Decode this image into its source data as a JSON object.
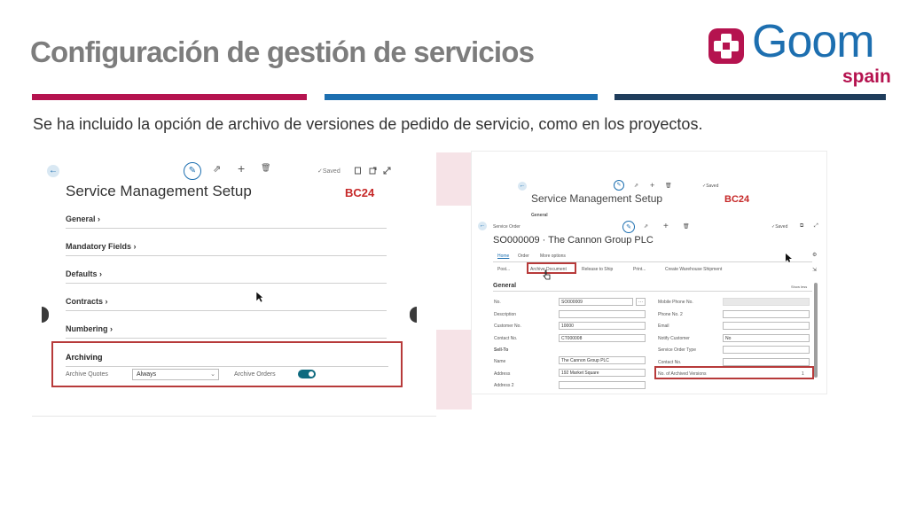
{
  "slide": {
    "title": "Configuración de gestión de servicios",
    "subtitle": "Se ha incluido la opción de archivo de versiones de pedido de servicio, como en los proyectos.",
    "logo": {
      "name": "Goom",
      "region": "spain"
    }
  },
  "left_panel": {
    "toolbar": {
      "edit_icon": "✎",
      "share_icon": "⇗",
      "add_icon": "+",
      "delete_icon": "🗑",
      "saved": "✓Saved"
    },
    "page_title": "Service Management Setup",
    "badge": "BC24",
    "sections": [
      "General ›",
      "Mandatory Fields ›",
      "Defaults ›",
      "Contracts ›",
      "Numbering ›"
    ],
    "archiving": {
      "heading": "Archiving",
      "archive_quotes_label": "Archive Quotes",
      "archive_quotes_value": "Always",
      "archive_orders_label": "Archive Orders"
    }
  },
  "right_panel": {
    "setup_title": "Service Management Setup",
    "setup_badge": "BC24",
    "setup_general": "General",
    "saved": "✓Saved",
    "breadcrumb": "Service Order",
    "record_title": "SO000009 · The Cannon Group PLC",
    "tabs": [
      "Home",
      "Order",
      "More options"
    ],
    "actions": {
      "post": "Post...",
      "archive_document": "Archive Document",
      "release_to_ship": "Release to Ship",
      "print": "Print...",
      "create_warehouse_shipment": "Create Warehouse Shipment"
    },
    "general_heading": "General",
    "show_less": "Show less",
    "left_fields": [
      {
        "label": "No.",
        "value": "SO000009"
      },
      {
        "label": "Description",
        "value": ""
      },
      {
        "label": "Customer No.",
        "value": "10000"
      },
      {
        "label": "Contact No.",
        "value": "CT000008"
      }
    ],
    "sell_to_heading": "Sell-To",
    "sell_to_fields": [
      {
        "label": "Name",
        "value": "The Cannon Group PLC"
      },
      {
        "label": "Address",
        "value": "192 Market Square"
      },
      {
        "label": "Address 2",
        "value": ""
      }
    ],
    "right_fields": [
      {
        "label": "Mobile Phone No.",
        "value": ""
      },
      {
        "label": "Phone No. 2",
        "value": ""
      },
      {
        "label": "Email",
        "value": ""
      },
      {
        "label": "Notify Customer",
        "value": "No"
      },
      {
        "label": "Service Order Type",
        "value": ""
      },
      {
        "label": "Contact No.",
        "value": ""
      },
      {
        "label": "No. of Archived Versions",
        "value": "1"
      }
    ]
  },
  "colors": {
    "magenta": "#b5134f",
    "blue": "#1d6fb0",
    "navy": "#1f3d5c",
    "highlight_red": "#b73a3a",
    "toggle_teal": "#0e6a7f"
  }
}
